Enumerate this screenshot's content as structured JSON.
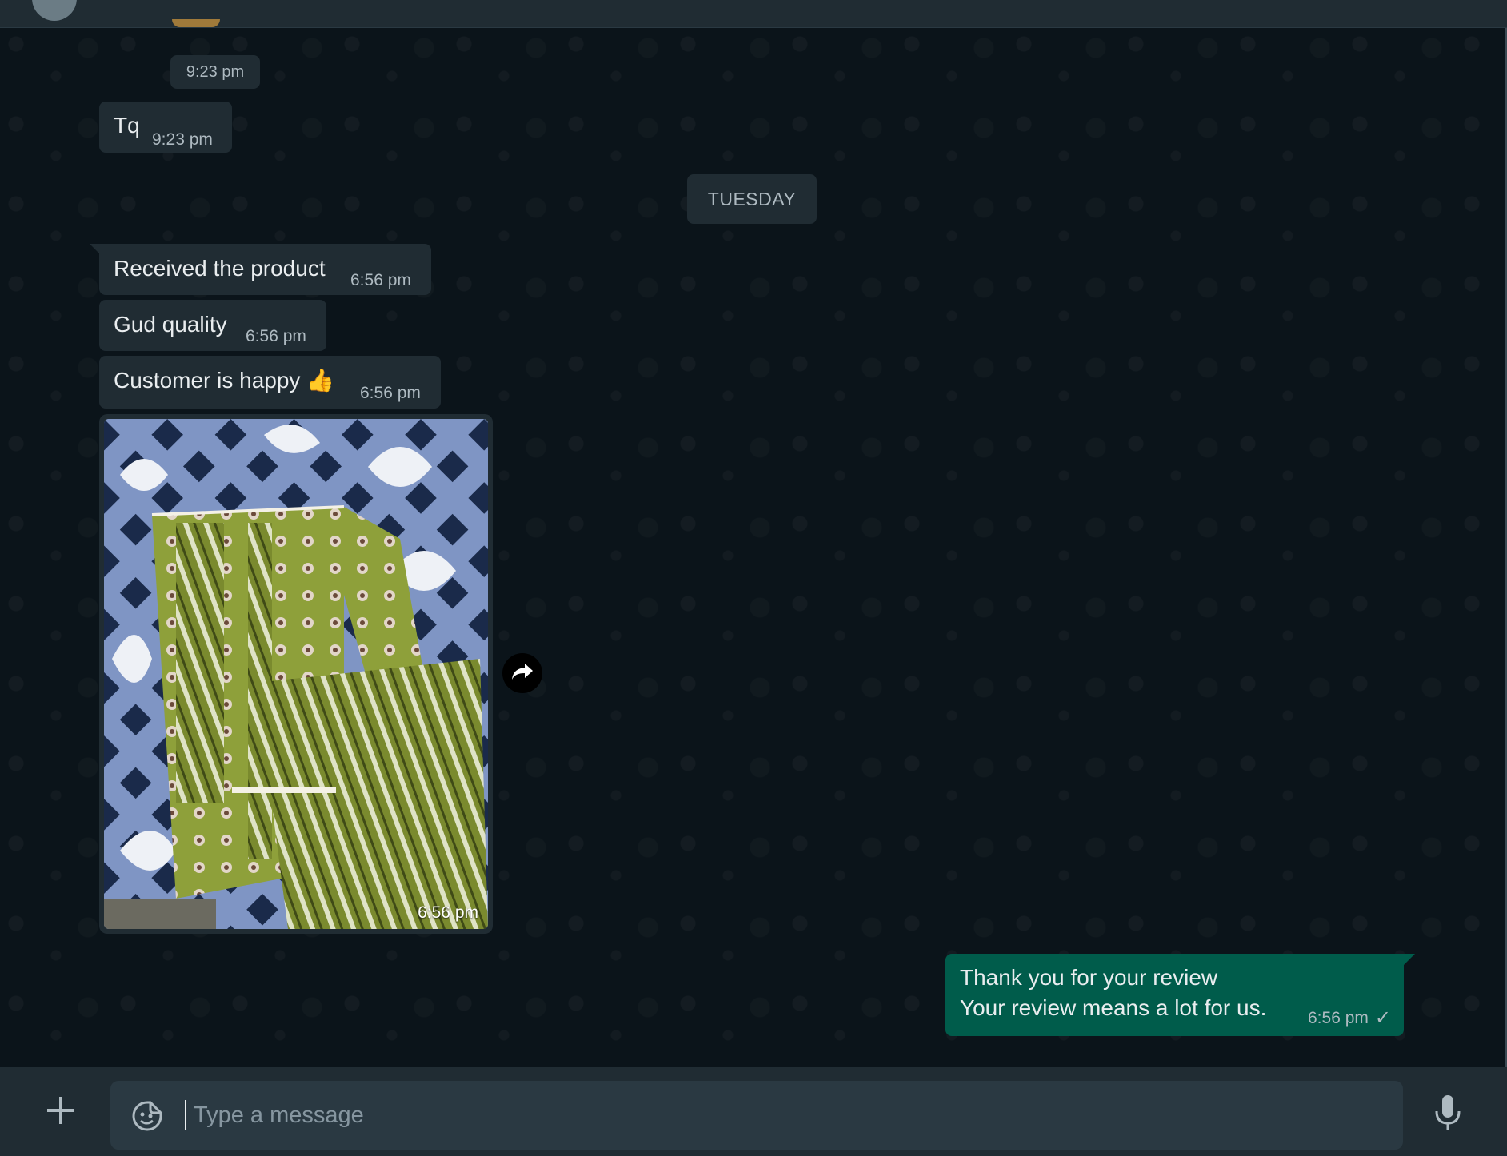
{
  "window": {
    "title": ""
  },
  "messages": {
    "first_time": "9:23 pm",
    "tq": {
      "text": "Tq",
      "time": "9:23 pm"
    },
    "day_separator": "TUESDAY",
    "received": {
      "text": "Received the product",
      "time": "6:56 pm"
    },
    "quality": {
      "text": "Gud quality",
      "time": "6:56 pm"
    },
    "happy": {
      "text": "Customer is happy 👍",
      "time": "6:56 pm"
    },
    "image": {
      "time": "6:56 pm"
    },
    "outgoing": {
      "line1": "Thank you for your review",
      "line2": "Your review means a lot for us.",
      "time": "6:56 pm",
      "status": "✓"
    }
  },
  "composer": {
    "placeholder": "Type a message",
    "value": ""
  },
  "icons": {
    "forward": "forward-arrow-icon",
    "attach": "plus-icon",
    "sticker": "sticker-icon",
    "mic": "microphone-icon",
    "tick": "single-tick-icon"
  },
  "colors": {
    "background": "#0b141a",
    "incoming_bubble": "#202c33",
    "outgoing_bubble": "#005c4b",
    "meta_text": "#aebac1",
    "composer_bar": "#202c33"
  }
}
